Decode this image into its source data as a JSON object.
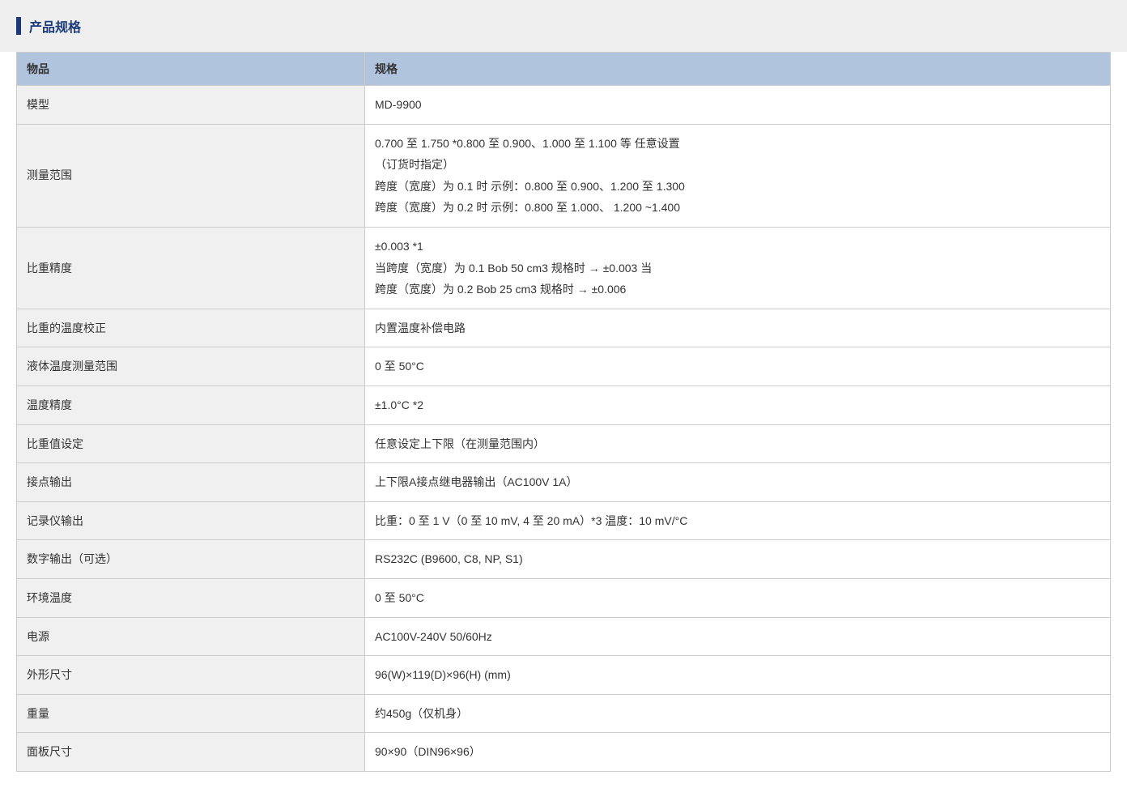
{
  "section": {
    "title": "产品规格"
  },
  "table": {
    "headers": {
      "item": "物品",
      "spec": "规格"
    },
    "rows": [
      {
        "item": "模型",
        "spec": "MD-9900"
      },
      {
        "item": "测量范围",
        "spec": "0.700 至 1.750 *0.800 至 0.900、1.000 至 1.100 等 任意设置\n（订货时指定）\n跨度（宽度）为 0.1 时 示例：0.800 至 0.900、1.200 至 1.300\n跨度（宽度）为 0.2 时 示例：0.800 至 1.000、 1.200 ~1.400"
      },
      {
        "item": "比重精度",
        "spec": "±0.003 *1\n当跨度（宽度）为 0.1 Bob 50 cm3 规格时 → ±0.003 当\n跨度（宽度）为 0.2 Bob 25 cm3 规格时 → ±0.006"
      },
      {
        "item": "比重的温度校正",
        "spec": "内置温度补偿电路"
      },
      {
        "item": "液体温度测量范围",
        "spec": "0 至 50°C"
      },
      {
        "item": "温度精度",
        "spec": "±1.0°C *2"
      },
      {
        "item": "比重值设定",
        "spec": "任意设定上下限（在测量范围内）"
      },
      {
        "item": "接点输出",
        "spec": "上下限A接点继电器输出（AC100V 1A）"
      },
      {
        "item": "记录仪输出",
        "spec": "比重：0 至 1 V（0 至 10 mV, 4 至 20 mA）*3 温度：10 mV/°C"
      },
      {
        "item": "数字输出（可选）",
        "spec": "RS232C (B9600, C8, NP, S1)"
      },
      {
        "item": "环境温度",
        "spec": "0 至 50°C"
      },
      {
        "item": "电源",
        "spec": "AC100V-240V 50/60Hz"
      },
      {
        "item": "外形尺寸",
        "spec": "96(W)×119(D)×96(H) (mm)"
      },
      {
        "item": "重量",
        "spec": "约450g（仅机身）"
      },
      {
        "item": "面板尺寸",
        "spec": "90×90（DIN96×96）"
      }
    ]
  }
}
